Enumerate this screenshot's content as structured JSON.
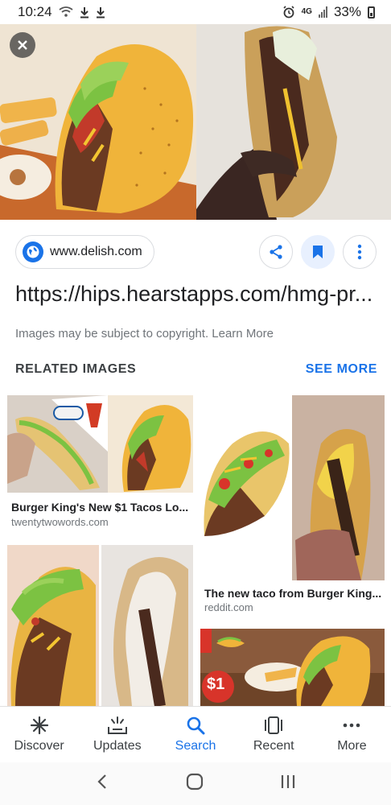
{
  "status_bar": {
    "time": "10:24",
    "network": "4G",
    "battery": "33%"
  },
  "source": {
    "domain": "www.delish.com"
  },
  "title": "https://hips.hearstapps.com/hmg-pr...",
  "copyright_text": "Images may be subject to copyright. Learn More",
  "related": {
    "header": "RELATED IMAGES",
    "see_more": "SEE MORE",
    "items": [
      {
        "caption": "Burger King's New $1 Tacos Lo...",
        "domain": "twentytwowords.com"
      },
      {
        "caption": "The new taco from Burger King....",
        "domain": "reddit.com"
      }
    ],
    "badge_price": "$1"
  },
  "bottom_nav": {
    "items": [
      {
        "label": "Discover",
        "icon": "asterisk-icon"
      },
      {
        "label": "Updates",
        "icon": "updates-icon"
      },
      {
        "label": "Search",
        "icon": "search-icon"
      },
      {
        "label": "Recent",
        "icon": "recent-icon"
      },
      {
        "label": "More",
        "icon": "more-dots-icon"
      }
    ],
    "active": "Search"
  },
  "colors": {
    "accent": "#1a73e8",
    "text": "#202124",
    "muted": "#70757a"
  }
}
